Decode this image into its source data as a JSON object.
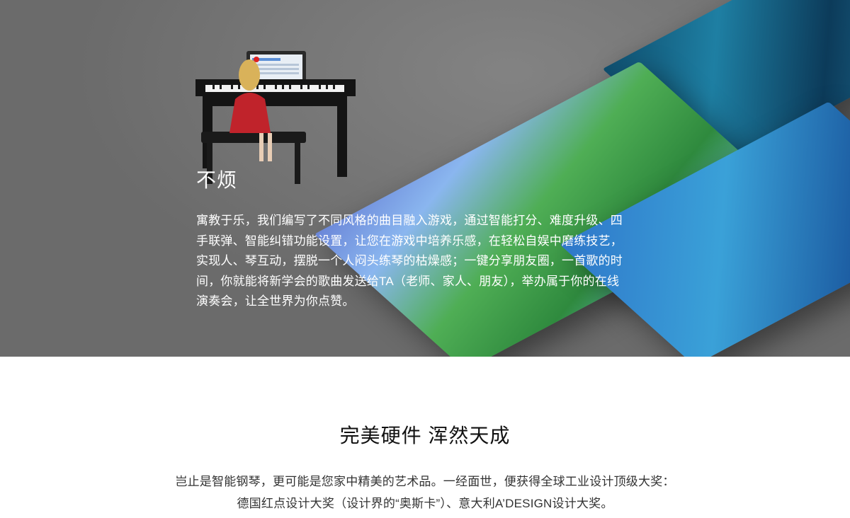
{
  "hero": {
    "title": "不烦",
    "description": "寓教于乐，我们编写了不同风格的曲目融入游戏，通过智能打分、难度升级、四手联弹、智能纠错功能设置，让您在游戏中培养乐感，在轻松自娱中磨练技艺，实现人、琴互动，摆脱一个人闷头练琴的枯燥感；一键分享朋友圈，一首歌的时间，你就能将新学会的歌曲发送给TA（老师、家人、朋友），举办属于你的在线演奏会，让全世界为你点赞。"
  },
  "section": {
    "title": "完美硬件  浑然天成",
    "line1": "岂止是智能钢琴，更可能是您家中精美的艺术品。一经面世，便获得全球工业设计顶级大奖：",
    "line2": "德国红点设计大奖（设计界的“奥斯卡”）、意大利A’DESIGN设计大奖。"
  },
  "icons": [
    "piano-illustration",
    "game-screenshot-top",
    "game-screenshot-mid",
    "game-screenshot-right"
  ]
}
